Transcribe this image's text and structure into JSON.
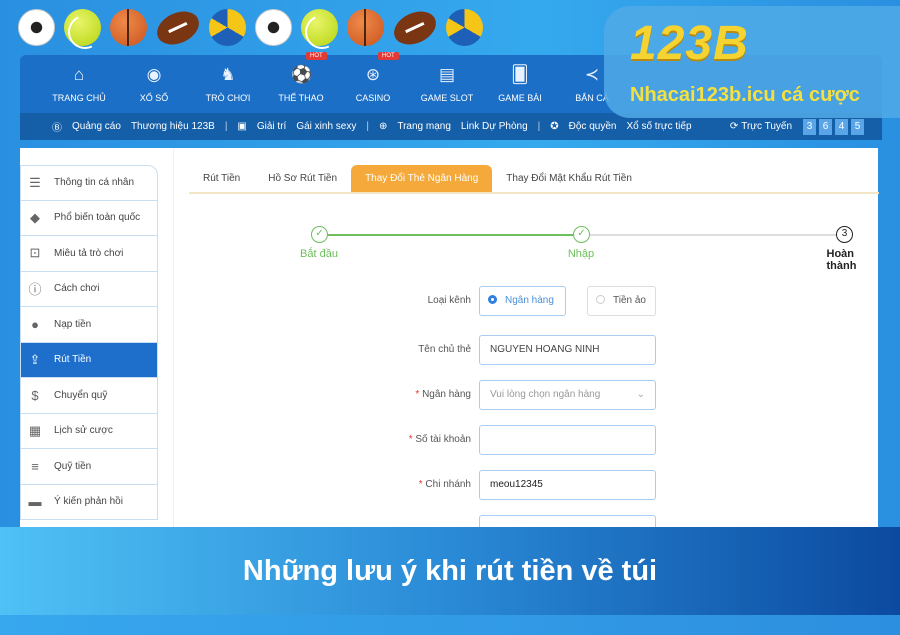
{
  "decor_balls": [
    "soccer",
    "tennis",
    "basketball",
    "football",
    "volleyball",
    "soccer",
    "tennis",
    "basketball",
    "football",
    "volleyball"
  ],
  "logo": {
    "mark": "123B",
    "subtitle": "Nhacai123b.icu cá cược"
  },
  "nav": [
    {
      "label": "TRANG CHỦ",
      "icon": "home-icon",
      "glyph": "⌂"
    },
    {
      "label": "XỔ SỐ",
      "icon": "lottery-ball-icon",
      "glyph": "◉"
    },
    {
      "label": "TRÒ CHƠI",
      "icon": "chess-knight-icon",
      "glyph": "♞"
    },
    {
      "label": "THỂ THAO",
      "icon": "soccer-ball-icon",
      "glyph": "⚽",
      "badge": "HOT"
    },
    {
      "label": "CASINO",
      "icon": "roulette-icon",
      "glyph": "⊛",
      "badge": "HOT"
    },
    {
      "label": "GAME SLOT",
      "icon": "slot-machine-icon",
      "glyph": "▤"
    },
    {
      "label": "GAME BÀI",
      "icon": "cards-icon",
      "glyph": "🂠"
    },
    {
      "label": "BẮN CÁ",
      "icon": "fish-icon",
      "glyph": "≺"
    }
  ],
  "subbar": {
    "ads_label": "Quảng cáo",
    "ads_value": "Thương hiệu 123B",
    "ent_label": "Giải trí",
    "ent_value": "Gái xinh sexy",
    "web_label": "Trang mạng",
    "web_value": "Link Dự Phòng",
    "excl_label": "Độc quyền",
    "excl_value": "Xổ số trực tiếp",
    "online_label": "Trực Tuyến",
    "online_digits": [
      "3",
      "6",
      "4",
      "5"
    ]
  },
  "sidebar": [
    {
      "label": "Thông tin cá nhân",
      "icon": "user-info-icon",
      "glyph": "☰"
    },
    {
      "label": "Phổ biến toàn quốc",
      "icon": "diamond-icon",
      "glyph": "◆"
    },
    {
      "label": "Miêu tả trò chơi",
      "icon": "gamepad-icon",
      "glyph": "⊡"
    },
    {
      "label": "Cách chơi",
      "icon": "info-icon",
      "glyph": "ⓘ"
    },
    {
      "label": "Nạp tiền",
      "icon": "piggy-bank-icon",
      "glyph": "●"
    },
    {
      "label": "Rút Tiền",
      "icon": "withdraw-icon",
      "glyph": "⇪",
      "active": true
    },
    {
      "label": "Chuyển quỹ",
      "icon": "dollar-circle-icon",
      "glyph": "$"
    },
    {
      "label": "Lịch sử cược",
      "icon": "clipboard-icon",
      "glyph": "▦"
    },
    {
      "label": "Quỹ tiền",
      "icon": "fund-icon",
      "glyph": "≡"
    },
    {
      "label": "Ý kiến phản hồi",
      "icon": "chat-icon",
      "glyph": "▬"
    }
  ],
  "tabs": [
    {
      "label": "Rút Tiền"
    },
    {
      "label": "Hồ Sơ Rút Tiền"
    },
    {
      "label": "Thay Đổi Thẻ Ngân Hàng",
      "active": true
    },
    {
      "label": "Thay Đổi Mật Khẩu Rút Tiền"
    }
  ],
  "stepper": {
    "steps": [
      {
        "label": "Bắt đầu",
        "state": "done"
      },
      {
        "label": "Nhập",
        "state": "done"
      },
      {
        "label": "Hoàn thành",
        "state": "current",
        "number": "3"
      }
    ],
    "done_color": "#6cbf5c"
  },
  "form": {
    "channel_label": "Loại kênh",
    "channel_options": [
      "Ngân hàng",
      "Tiền ảo"
    ],
    "channel_selected": "Ngân hàng",
    "holder_label": "Tên chủ thẻ",
    "holder_value": "NGUYEN HOANG NINH",
    "bank_label": "Ngân hàng",
    "bank_placeholder": "Vui lòng chọn ngân hàng",
    "account_label": "Số tài khoản",
    "account_value": "",
    "branch_label": "Chi nhánh",
    "branch_value": "meou12345"
  },
  "banner": {
    "title": "Những lưu ý khi rút tiền về túi"
  },
  "colors": {
    "nav": "#1c6fc6",
    "active_tab": "#f5a93a",
    "sidebar_active": "#1e6fcc",
    "logo_gold": "#f5d330"
  }
}
